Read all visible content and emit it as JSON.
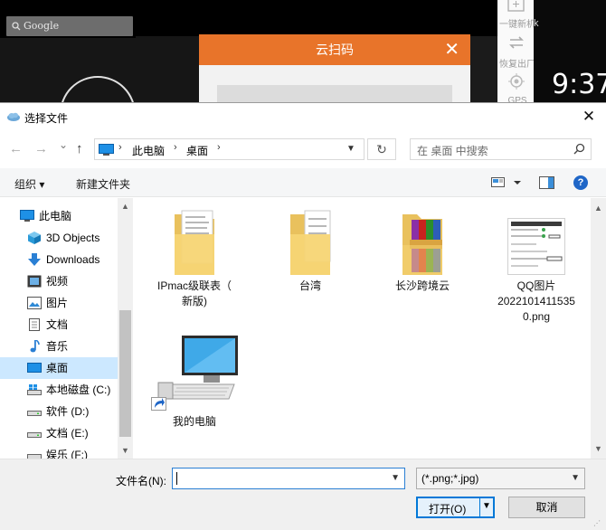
{
  "background": {
    "google_label": "Google",
    "orange_dialog_title": "云扫码",
    "orange_close": "✕",
    "side_labels": [
      "一键新机",
      "恢复出厂",
      "GPS"
    ],
    "clock_time": "9:37",
    "clock_prefix": "k"
  },
  "dialog": {
    "title": "选择文件",
    "close": "✕"
  },
  "nav": {
    "back": "←",
    "forward": "→",
    "recent": "⌄",
    "up": "↑",
    "breadcrumbs": [
      "此电脑",
      "桌面"
    ],
    "separator": "›",
    "refresh": "↻",
    "search_placeholder": "在 桌面 中搜索"
  },
  "toolbar": {
    "organize": "组织 ▾",
    "new_folder": "新建文件夹",
    "help": "?"
  },
  "sidebar": {
    "items": [
      {
        "label": "此电脑",
        "icon": "pc-icon"
      },
      {
        "label": "3D Objects",
        "icon": "cube-icon"
      },
      {
        "label": "Downloads",
        "icon": "download-arrow-icon"
      },
      {
        "label": "视频",
        "icon": "film-icon"
      },
      {
        "label": "图片",
        "icon": "picture-icon"
      },
      {
        "label": "文档",
        "icon": "document-icon"
      },
      {
        "label": "音乐",
        "icon": "music-note-icon"
      },
      {
        "label": "桌面",
        "icon": "desktop-icon"
      },
      {
        "label": "本地磁盘 (C:)",
        "icon": "windows-drive-icon"
      },
      {
        "label": "软件 (D:)",
        "icon": "drive-icon"
      },
      {
        "label": "文档 (E:)",
        "icon": "drive-icon"
      },
      {
        "label": "娱乐 (F:)",
        "icon": "drive-icon"
      }
    ],
    "selected_index": 7
  },
  "files": [
    {
      "name": "IPmac级联表（新版)",
      "line1": "IPmac级联表（",
      "line2": "新版)",
      "line3": "",
      "icon": "folder-docs-icon"
    },
    {
      "name": "台湾",
      "line1": "台湾",
      "line2": "",
      "line3": "",
      "icon": "folder-docs-icon"
    },
    {
      "name": "长沙跨境云",
      "line1": "长沙跨境云",
      "line2": "",
      "line3": "",
      "icon": "folder-winrar-icon"
    },
    {
      "name": "QQ图片20221014115350.png",
      "line1": "QQ图片",
      "line2": "2022101411535",
      "line3": "0.png",
      "icon": "image-thumbnail-icon"
    },
    {
      "name": "我的电脑",
      "line1": "我的电脑",
      "line2": "",
      "line3": "",
      "icon": "computer-shortcut-icon"
    }
  ],
  "bottom": {
    "filename_label": "文件名(N):",
    "filename_value": "",
    "filetype_value": "(*.png;*.jpg)",
    "open_label": "打开(O)",
    "cancel_label": "取消"
  },
  "colors": {
    "accent_orange": "#e8742a",
    "selection": "#cce8ff",
    "focus_blue": "#0078d7",
    "help_blue": "#1f66c7"
  }
}
